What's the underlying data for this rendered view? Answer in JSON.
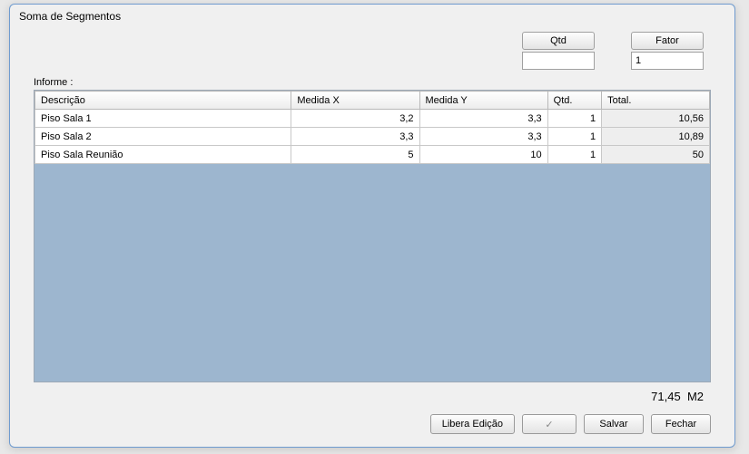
{
  "dialog": {
    "title": "Soma de Segmentos"
  },
  "top": {
    "qtd_label": "Qtd",
    "qtd_value": "",
    "fator_label": "Fator",
    "fator_value": "1"
  },
  "informe_label": "Informe :",
  "columns": {
    "descricao": "Descrição",
    "medida_x": "Medida X",
    "medida_y": "Medida Y",
    "qtd": "Qtd.",
    "total": "Total."
  },
  "rows": [
    {
      "descricao": "Piso Sala 1",
      "medida_x": "3,2",
      "medida_y": "3,3",
      "qtd": "1",
      "total": "10,56"
    },
    {
      "descricao": "Piso Sala 2",
      "medida_x": "3,3",
      "medida_y": "3,3",
      "qtd": "1",
      "total": "10,89"
    },
    {
      "descricao": "Piso Sala Reunião",
      "medida_x": "5",
      "medida_y": "10",
      "qtd": "1",
      "total": "50"
    }
  ],
  "footer": {
    "sum": "71,45",
    "unit": "M2"
  },
  "buttons": {
    "libera": "Libera Edição",
    "confirm": "✓",
    "salvar": "Salvar",
    "fechar": "Fechar"
  }
}
